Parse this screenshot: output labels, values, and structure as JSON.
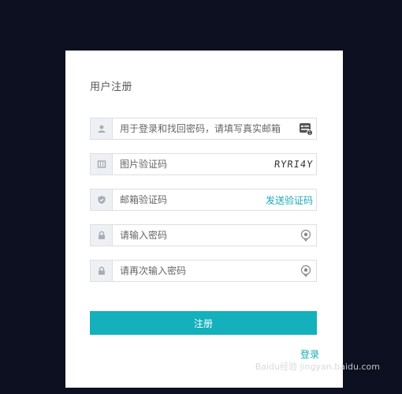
{
  "form": {
    "title": "用户注册",
    "fields": [
      {
        "placeholder": "用于登录和找回密码，请填写真实邮箱",
        "lead_icon": "user-icon",
        "trail_icon": "id-card-icon"
      },
      {
        "placeholder": "图片验证码",
        "lead_icon": "image-icon",
        "captcha": "RYRI4Y"
      },
      {
        "placeholder": "邮箱验证码",
        "lead_icon": "shield-icon",
        "send_label": "发送验证码"
      },
      {
        "placeholder": "请输入密码",
        "lead_icon": "lock-icon",
        "trail_icon": "eye-icon"
      },
      {
        "placeholder": "请再次输入密码",
        "lead_icon": "lock-icon",
        "trail_icon": "eye-icon"
      }
    ],
    "submit_label": "注册",
    "login_label": "登录"
  },
  "colors": {
    "background": "#0d1020",
    "accent": "#14b0bc",
    "link": "#1aa9b8"
  },
  "watermark": "Baidu经验 jingyan.baidu.com"
}
